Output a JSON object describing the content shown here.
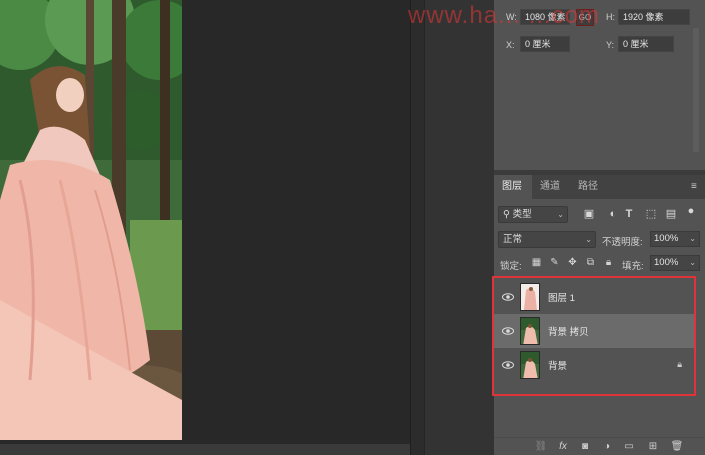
{
  "watermark": "www.ha... ...com",
  "properties": {
    "w_label": "W:",
    "w_value": "1080 像素",
    "link_label": "GO",
    "h_label": "H:",
    "h_value": "1920 像素",
    "x_label": "X:",
    "x_value": "0 厘米",
    "y_label": "Y:",
    "y_value": "0 厘米"
  },
  "tabs": [
    {
      "label": "图层",
      "active": true
    },
    {
      "label": "通道",
      "active": false
    },
    {
      "label": "路径",
      "active": false
    }
  ],
  "filter": {
    "kind_label": "类型",
    "icons": [
      "image-filter-icon",
      "adjustment-filter-icon",
      "type-filter-icon",
      "shape-filter-icon",
      "smart-object-filter-icon",
      "filter-toggle-icon"
    ]
  },
  "blend": {
    "mode": "正常",
    "opacity_label": "不透明度:",
    "opacity_value": "100%"
  },
  "lock": {
    "label": "锁定:",
    "icons": [
      "lock-transparent-icon",
      "lock-image-icon",
      "lock-position-icon",
      "lock-artboard-icon",
      "lock-all-icon"
    ],
    "fill_label": "填充:",
    "fill_value": "100%"
  },
  "layers": [
    {
      "name": "图层 1",
      "selected": false,
      "locked": false
    },
    {
      "name": "背景 拷贝",
      "selected": true,
      "locked": false
    },
    {
      "name": "背景",
      "selected": false,
      "locked": true
    }
  ],
  "bottom_icons": [
    "link-layers-icon",
    "fx-icon",
    "mask-icon",
    "adjustment-icon",
    "group-icon",
    "new-layer-icon",
    "trash-icon"
  ],
  "bottom_fx_label": "fx"
}
